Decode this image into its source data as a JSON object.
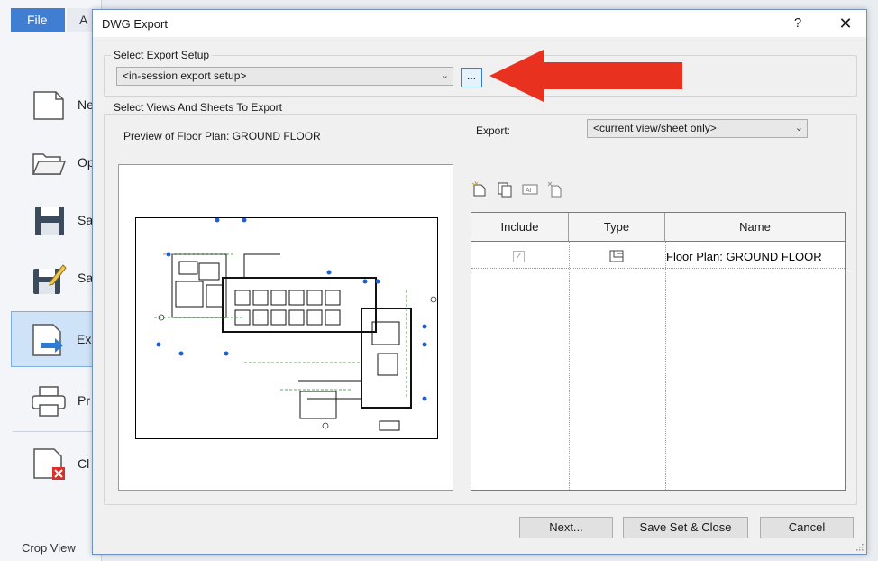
{
  "app": {
    "file_tab": "File",
    "second_tab": "A",
    "menu_items": [
      {
        "label": "Ne",
        "icon": "new-document-icon"
      },
      {
        "label": "Op",
        "icon": "open-folder-icon"
      },
      {
        "label": "Sa",
        "icon": "save-icon"
      },
      {
        "label": "Sa",
        "icon": "save-as-icon"
      },
      {
        "label": "Ex",
        "icon": "export-icon"
      },
      {
        "label": "Pr",
        "icon": "print-icon"
      },
      {
        "label": "Cl",
        "icon": "close-document-icon"
      }
    ],
    "bottom_text": "Crop View"
  },
  "dialog": {
    "title": "DWG Export",
    "help_label": "?",
    "close_label": "✕",
    "export_setup": {
      "group_title": "Select Export Setup",
      "value": "<in-session export setup>",
      "modify_button": "..."
    },
    "views_group": {
      "group_title": "Select Views And Sheets To Export",
      "preview_label": "Preview of Floor Plan: GROUND FLOOR",
      "export_label": "Export:",
      "export_value": "<current view/sheet only>"
    },
    "toolbar_icons": [
      "new-set-icon",
      "duplicate-set-icon",
      "rename-set-icon",
      "delete-set-icon"
    ],
    "table": {
      "columns": [
        "Include",
        "Type",
        "Name"
      ],
      "rows": [
        {
          "include": true,
          "type_icon": "floor-plan-view-icon",
          "name": "Floor Plan: GROUND FLOOR"
        }
      ]
    },
    "buttons": {
      "next": "Next...",
      "save_close": "Save Set & Close",
      "cancel": "Cancel"
    }
  },
  "colors": {
    "file_tab": "#3f7ed0",
    "annotation_arrow": "#e8321f",
    "selected_menu": "#cfe3f8"
  }
}
